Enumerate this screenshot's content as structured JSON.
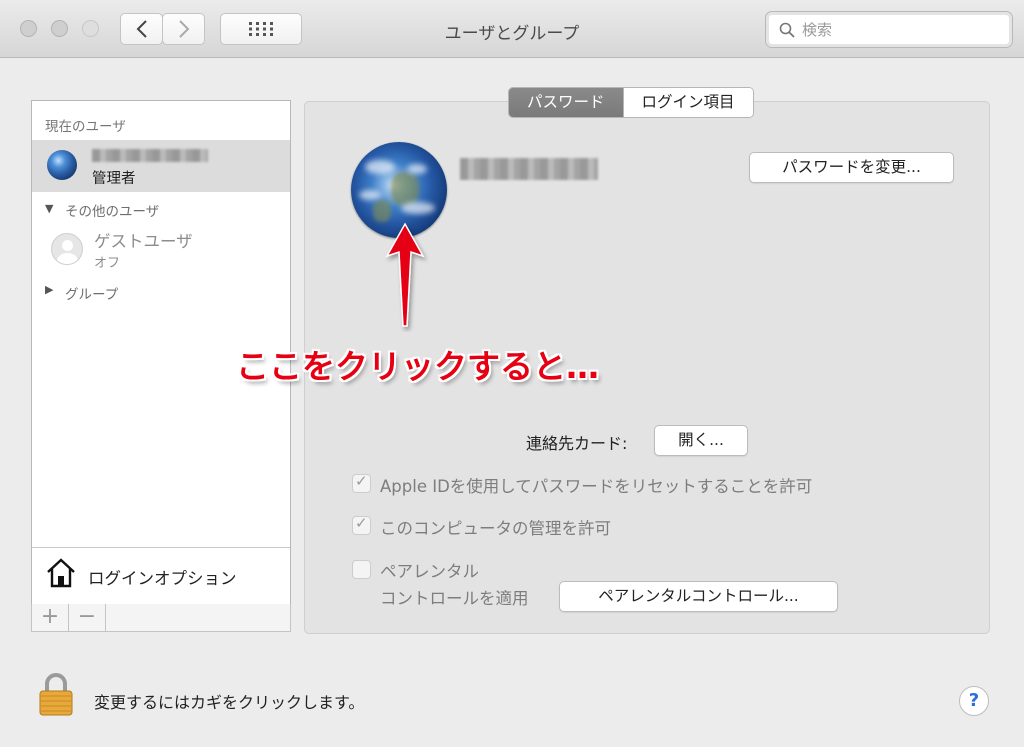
{
  "window": {
    "title": "ユーザとグループ"
  },
  "search": {
    "placeholder": "検索"
  },
  "sidebar": {
    "current_users_header": "現在のユーザ",
    "current_user_role": "管理者",
    "other_users_header": "その他のユーザ",
    "guest_name": "ゲストユーザ",
    "guest_status": "オフ",
    "groups_header": "グループ",
    "login_options": "ログインオプション",
    "add_label": "+",
    "remove_label": "−"
  },
  "tabs": [
    {
      "label": "パスワード",
      "active": true
    },
    {
      "label": "ログイン項目",
      "active": false
    }
  ],
  "main": {
    "change_password_button": "パスワードを変更...",
    "contacts_card_label": "連絡先カード:",
    "open_button": "開く...",
    "apple_id_reset_label": "Apple IDを使用してパスワードをリセットすることを許可",
    "apple_id_reset_checked": true,
    "admin_allow_label": "このコンピュータの管理を許可",
    "admin_allow_checked": true,
    "parental_label_line1": "ペアレンタル",
    "parental_label_line2": "コントロールを適用",
    "parental_checked": false,
    "parental_button": "ペアレンタルコントロール..."
  },
  "annotation": {
    "text": "ここをクリックすると…",
    "color": "#e60012"
  },
  "footer": {
    "lock_text": "変更するにはカギをクリックします。",
    "help_label": "?"
  }
}
